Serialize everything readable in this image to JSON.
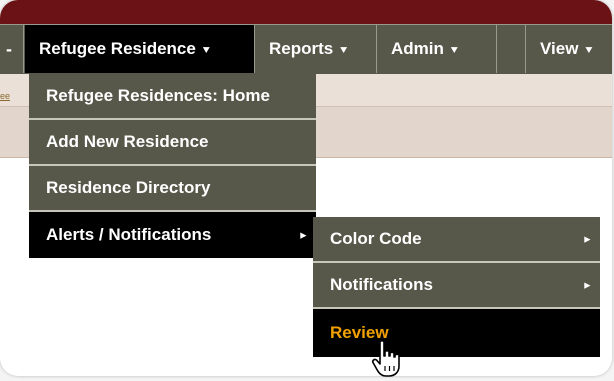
{
  "navbar": {
    "edge_glyph": "-",
    "caret_glyph": "⯆",
    "items": [
      {
        "label": "Refugee Residence"
      },
      {
        "label": "Reports"
      },
      {
        "label": "Admin"
      },
      {
        "label": ""
      },
      {
        "label": "View"
      }
    ]
  },
  "breadcrumb": {
    "fragment": "ee"
  },
  "dropdown": {
    "items": [
      {
        "label": "Refugee Residences: Home"
      },
      {
        "label": "Add New Residence"
      },
      {
        "label": "Residence Directory"
      },
      {
        "label": "Alerts / Notifications",
        "arrow": "▸"
      }
    ]
  },
  "submenu": {
    "items": [
      {
        "label": "Color Code",
        "arrow": "▸"
      },
      {
        "label": "Notifications",
        "arrow": "▸"
      },
      {
        "label": "Review"
      }
    ]
  },
  "colors": {
    "brand_bar": "#6b1216",
    "menu_bg": "#57574a",
    "active_bg": "#000000",
    "hover_text": "#f0a000"
  },
  "icons": {
    "cursor": "hand-pointer-icon"
  }
}
